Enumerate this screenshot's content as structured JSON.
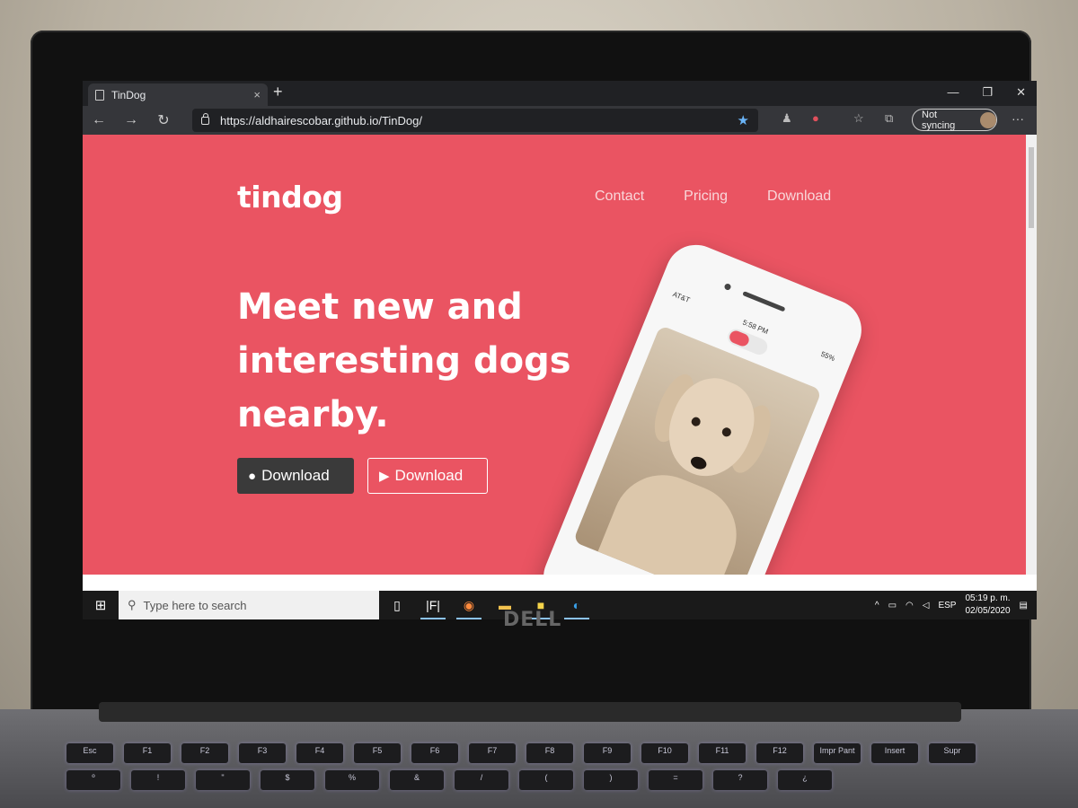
{
  "browser": {
    "tab_title": "TinDog",
    "tab_close": "×",
    "new_tab": "+",
    "window_controls": [
      "—",
      "❐",
      "✕"
    ],
    "nav_icons": [
      "←",
      "→",
      "↻"
    ],
    "url": "https://aldhairescobar.github.io/TinDog/",
    "sync_label": "Not syncing",
    "more": "···"
  },
  "site": {
    "brand": "tindog",
    "nav": [
      "Contact",
      "Pricing",
      "Download"
    ],
    "headline": "Meet new and interesting dogs nearby.",
    "buttons": {
      "apple": "Download",
      "google": "Download"
    },
    "colors": {
      "background": "#ea5462",
      "dark_button": "#3a3a3a",
      "text": "#ffffff"
    }
  },
  "phone": {
    "carrier": "AT&T",
    "time": "5:58 PM",
    "battery": "55%"
  },
  "taskbar": {
    "search_placeholder": "Type here to search",
    "language": "ESP",
    "time": "05:19 p. m.",
    "date": "02/05/2020"
  },
  "laptop": {
    "brand": "DELL"
  },
  "keyboard": {
    "row1": [
      "Esc",
      "F1",
      "F2",
      "F3",
      "F4",
      "F5",
      "F6",
      "F7",
      "F8",
      "F9",
      "F10",
      "F11",
      "F12",
      "Impr Pant",
      "Insert",
      "Supr"
    ],
    "row2": [
      "º",
      "!",
      "\"",
      "$",
      "%",
      "&",
      "/",
      "(",
      ")",
      "=",
      "?",
      "¿"
    ]
  }
}
